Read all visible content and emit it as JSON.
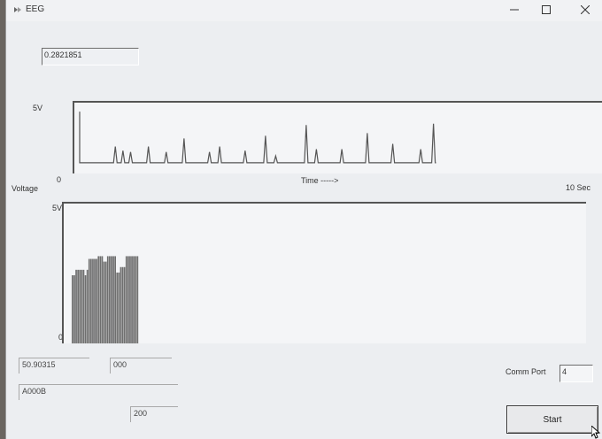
{
  "window": {
    "title": "EEG",
    "controls": [
      "minimize",
      "maximize",
      "close"
    ]
  },
  "top_value": "0.2821851",
  "plot1": {
    "y_max_label": "5V",
    "x_min_label": "0",
    "x_label": "Time ----->",
    "x_max_label": "10 Sec",
    "y_axis_label": "Voltage"
  },
  "plot2": {
    "y_max_label": "5V",
    "y_min_label": "0"
  },
  "readings": {
    "value_a": "50.90315",
    "value_b": "000",
    "value_c": "A000B",
    "value_d": "200"
  },
  "comm_port": {
    "label": "Comm Port",
    "value": "4"
  },
  "start_button": "Start",
  "chart_data": [
    {
      "type": "line",
      "xlabel": "Time ----->",
      "ylabel": "Voltage",
      "xlim": [
        0,
        10
      ],
      "ylim": [
        0,
        5
      ],
      "baseline": 0.8,
      "spikes": [
        {
          "t": 0.0,
          "v": 4.6
        },
        {
          "t": 0.7,
          "v": 2.0
        },
        {
          "t": 0.85,
          "v": 1.7
        },
        {
          "t": 1.0,
          "v": 1.6
        },
        {
          "t": 1.35,
          "v": 2.0
        },
        {
          "t": 1.7,
          "v": 1.6
        },
        {
          "t": 2.05,
          "v": 2.6
        },
        {
          "t": 2.55,
          "v": 1.6
        },
        {
          "t": 2.75,
          "v": 2.0
        },
        {
          "t": 3.25,
          "v": 1.7
        },
        {
          "t": 3.65,
          "v": 2.8
        },
        {
          "t": 3.85,
          "v": 1.3
        },
        {
          "t": 4.45,
          "v": 3.6
        },
        {
          "t": 4.65,
          "v": 1.8
        },
        {
          "t": 5.15,
          "v": 1.8
        },
        {
          "t": 5.65,
          "v": 3.0
        },
        {
          "t": 6.15,
          "v": 2.2
        },
        {
          "t": 6.7,
          "v": 1.8
        },
        {
          "t": 6.95,
          "v": 3.7
        }
      ]
    },
    {
      "type": "bar",
      "ylim": [
        0,
        5
      ],
      "values": [
        2.5,
        2.5,
        2.7,
        2.7,
        2.7,
        2.7,
        2.7,
        2.5,
        2.7,
        3.1,
        3.1,
        3.1,
        3.1,
        3.1,
        3.2,
        3.2,
        3.2,
        3.0,
        3.0,
        3.2,
        3.2,
        3.2,
        3.2,
        3.2,
        2.6,
        2.6,
        2.8,
        2.8,
        2.8,
        3.2,
        3.2,
        3.2,
        3.2,
        3.2,
        3.2,
        3.2
      ]
    }
  ]
}
